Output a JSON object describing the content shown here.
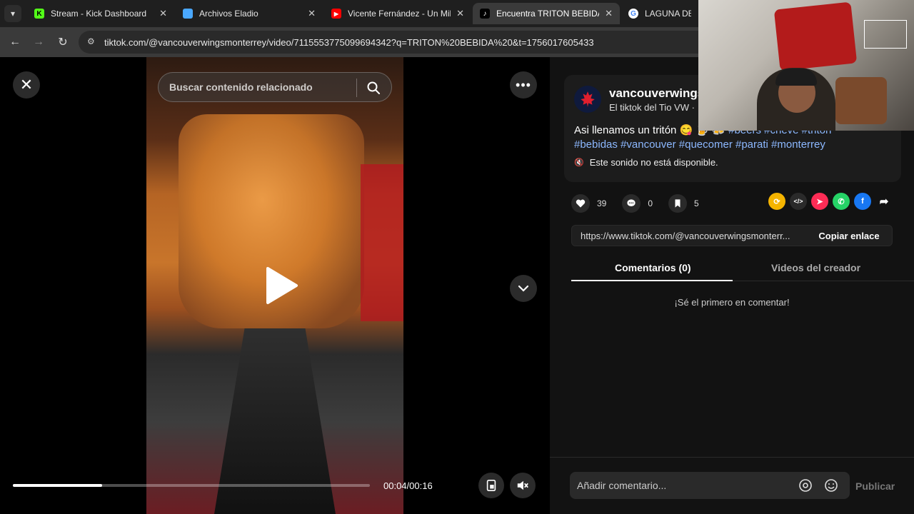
{
  "browser": {
    "tabs": [
      {
        "label": "Stream - Kick Dashboard",
        "favicon": "kick-icon",
        "color": "#53fc18"
      },
      {
        "label": "Archivos Eladio",
        "favicon": "file-icon",
        "color": "#4aa8ff"
      },
      {
        "label": "Vicente Fernández - Un Mill",
        "favicon": "youtube-icon",
        "color": "#ff0000"
      },
      {
        "label": "Encuentra TRITON BEBIDA",
        "favicon": "tiktok-icon",
        "color": "#000000",
        "active": true
      },
      {
        "label": "LAGUNA DEL PI",
        "favicon": "google-icon",
        "color": "#4285f4"
      }
    ],
    "url": "tiktok.com/@vancouverwingsmonterrey/video/7115553775099694342?q=TRITON%20BEBIDA%20&t=1756017605433"
  },
  "video": {
    "search_placeholder": "Buscar contenido relacionado",
    "time": "00:04/00:16",
    "progress": 0.25
  },
  "post": {
    "username": "vancouverwings",
    "nickname": "El tiktok del Tio VW ·",
    "caption_text": "Asi llenamos un tritón 😋 🍺 🍻 ",
    "hashtags_line1": "#beers #cheve #triton",
    "hashtags_line2": "#bebidas #vancouver #quecomer #parati #monterrey",
    "sound": "Este sonido no está disponible.",
    "likes": "39",
    "comments": "0",
    "saves": "5",
    "share_url": "https://www.tiktok.com/@vancouverwingsmonterr...",
    "copy_label": "Copiar enlace",
    "tab_comments": "Comentarios (0)",
    "tab_creator": "Videos del creador",
    "empty_comments": "¡Sé el primero en comentar!",
    "comment_placeholder": "Añadir comentario...",
    "publish": "Publicar"
  }
}
